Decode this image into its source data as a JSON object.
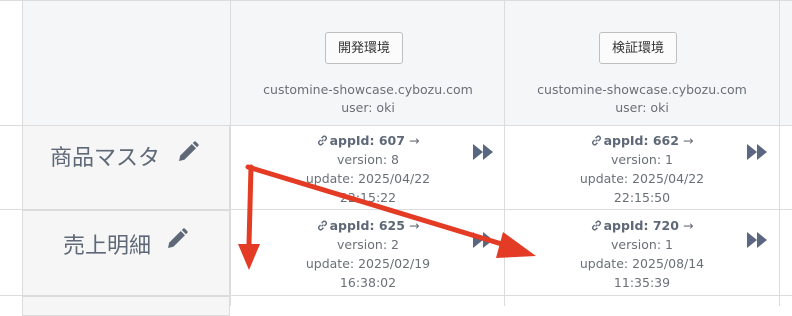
{
  "environments": [
    {
      "button_label": "開発環境",
      "host": "customine-showcase.cybozu.com",
      "user": "user: oki"
    },
    {
      "button_label": "検証環境",
      "host": "customine-showcase.cybozu.com",
      "user": "user: oki"
    }
  ],
  "rows": [
    {
      "name": "商品マスタ",
      "cells": [
        {
          "appid_label": "appId: 607",
          "version": "version: 8",
          "update": "update: 2025/04/22",
          "time": "22:15:22"
        },
        {
          "appid_label": "appId: 662",
          "version": "version: 1",
          "update": "update: 2025/04/22",
          "time": "22:15:50"
        }
      ]
    },
    {
      "name": "売上明細",
      "cells": [
        {
          "appid_label": "appId: 625",
          "version": "version: 2",
          "update": "update: 2025/02/19",
          "time": "16:38:02"
        },
        {
          "appid_label": "appId: 720",
          "version": "version: 1",
          "update": "update: 2025/08/14",
          "time": "11:35:39"
        }
      ]
    }
  ],
  "glyphs": {
    "arrow": "→"
  },
  "icons": {
    "edit": "pencil-icon",
    "link": "link-icon",
    "deploy": "fast-forward-icon"
  },
  "colors": {
    "annotation_arrow": "#e43b24",
    "deploy_icon": "#5a6780",
    "header_bg": "#f5f6f7"
  }
}
